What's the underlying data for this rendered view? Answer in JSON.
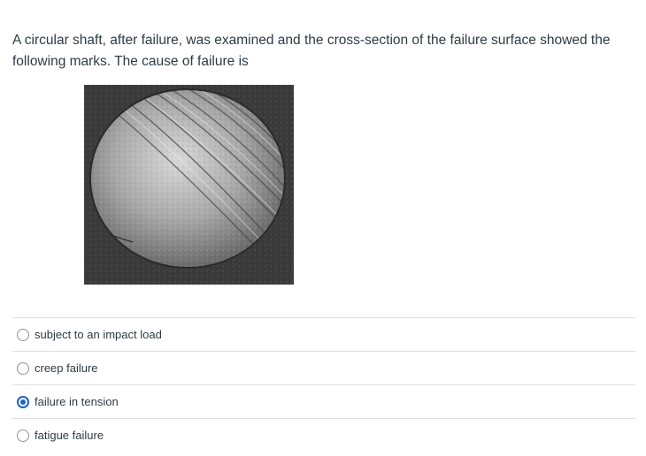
{
  "question": {
    "text": "A circular shaft, after failure, was examined and the cross-section of the failure surface showed the following marks. The cause of failure is"
  },
  "figure": {
    "description_icon": "fracture-surface-photo"
  },
  "answers": [
    {
      "label": "subject to an impact load",
      "selected": false
    },
    {
      "label": "creep failure",
      "selected": false
    },
    {
      "label": "failure in tension",
      "selected": true
    },
    {
      "label": "fatigue failure",
      "selected": false
    }
  ],
  "colors": {
    "text": "#2d3b45",
    "accent": "#1d64c7",
    "divider": "#dcdfe2"
  }
}
